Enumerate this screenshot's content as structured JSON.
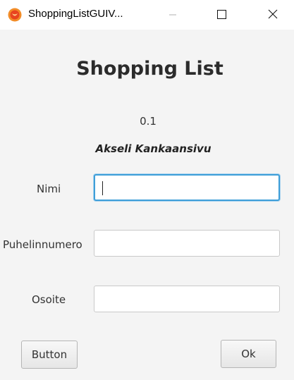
{
  "window": {
    "title": "ShoppingListGUIV...",
    "icon": "app-icon",
    "controls": [
      "minimize-icon",
      "maximize-icon",
      "close-icon"
    ]
  },
  "header": {
    "title": "Shopping List",
    "version": "0.1",
    "author": "Akseli Kankaansivu"
  },
  "form": {
    "name_label": "Nimi",
    "name_value": "",
    "phone_label": "Puhelinnumero",
    "phone_value": "",
    "address_label": "Osoite",
    "address_value": ""
  },
  "buttons": {
    "left_label": "Button",
    "ok_label": "Ok"
  },
  "colors": {
    "focus_border": "#3e9ed8",
    "background": "#f4f4f4",
    "icon_orange": "#f28c28"
  }
}
